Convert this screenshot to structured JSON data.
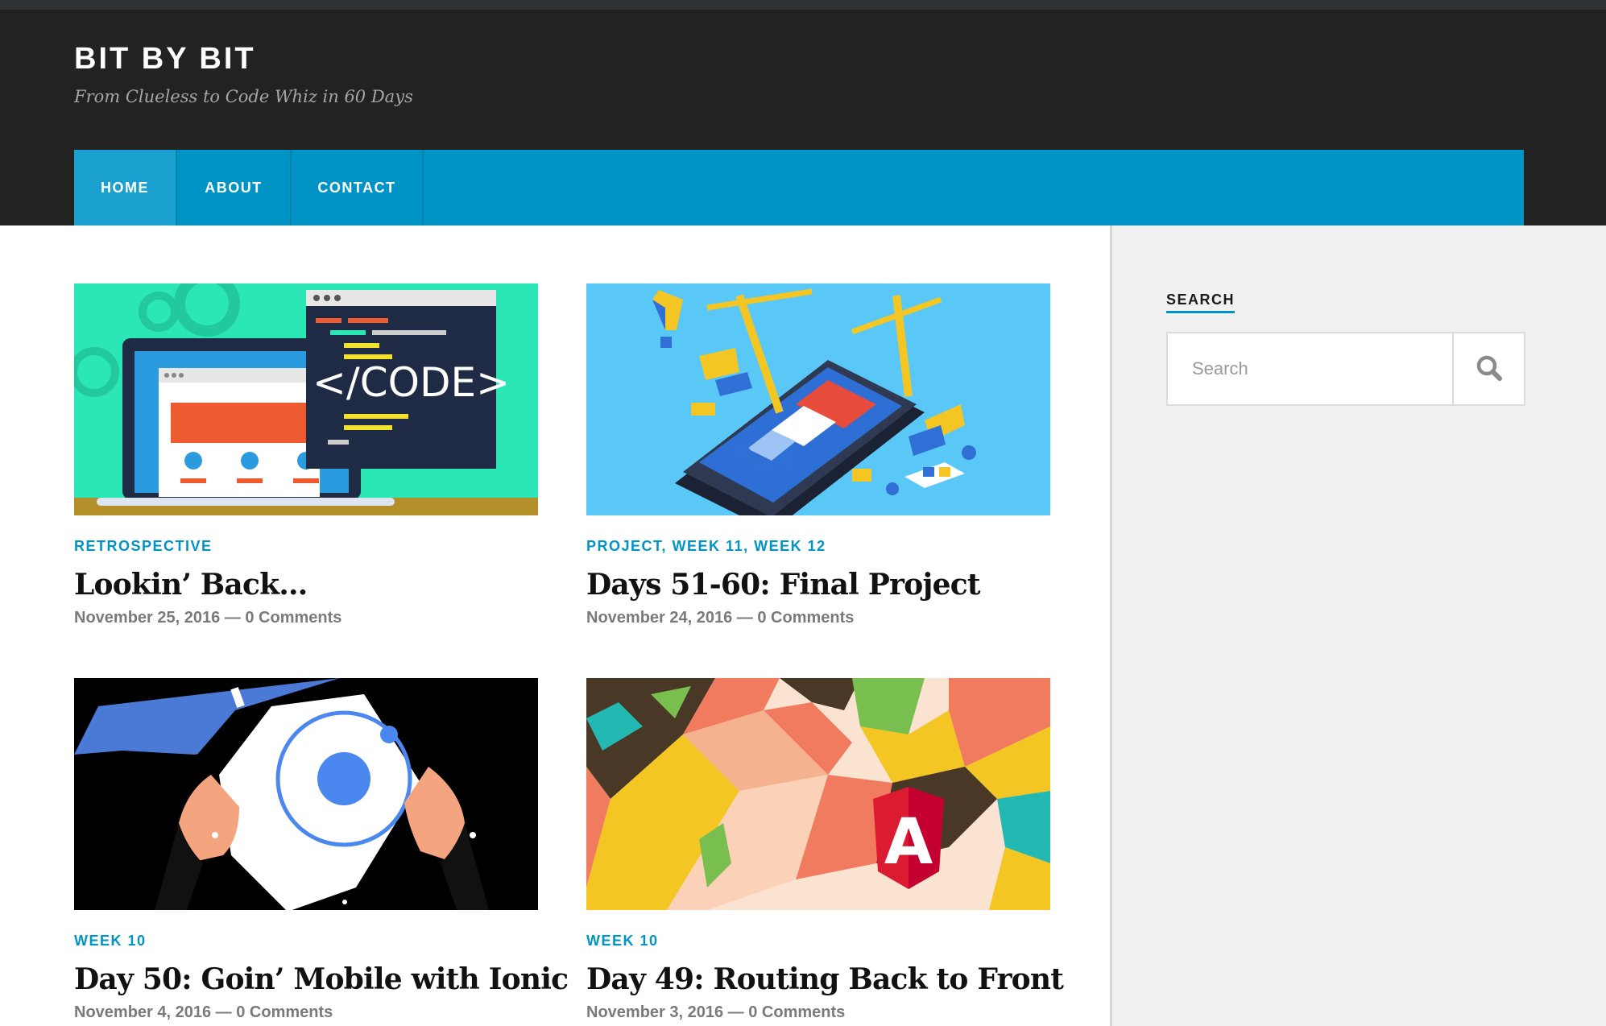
{
  "site": {
    "title": "BIT BY BIT",
    "description": "From Clueless to Code Whiz in 60 Days"
  },
  "nav": {
    "items": [
      {
        "label": "HOME",
        "active": true
      },
      {
        "label": "ABOUT",
        "active": false
      },
      {
        "label": "CONTACT",
        "active": false
      }
    ]
  },
  "posts": [
    {
      "categories": [
        "RETROSPECTIVE"
      ],
      "title": "Lookin’ Back…",
      "date": "November 25, 2016",
      "separator": "—",
      "comments": "0 Comments",
      "thumbnail": "code-illustration"
    },
    {
      "categories": [
        "PROJECT",
        "WEEK 11",
        "WEEK 12"
      ],
      "category_separator": ", ",
      "title": "Days 51-60: Final Project",
      "date": "November 24, 2016",
      "separator": "—",
      "comments": "0 Comments",
      "thumbnail": "app-construction-illustration"
    },
    {
      "categories": [
        "WEEK 10"
      ],
      "title": "Day 50: Goin’ Mobile with Ionic",
      "date": "November 4, 2016",
      "separator": "—",
      "comments": "0 Comments",
      "thumbnail": "ionic-logo-superhero"
    },
    {
      "categories": [
        "WEEK 10"
      ],
      "title": "Day 49: Routing Back to Front",
      "date": "November 3, 2016",
      "separator": "—",
      "comments": "0 Comments",
      "thumbnail": "angular-logo-origami"
    }
  ],
  "sidebar": {
    "search": {
      "heading": "SEARCH",
      "placeholder": "Search",
      "button_icon": "search-icon"
    }
  },
  "colors": {
    "accent": "#0093c5",
    "header_bg": "#222222",
    "sidebar_bg": "#f1f1f1"
  }
}
